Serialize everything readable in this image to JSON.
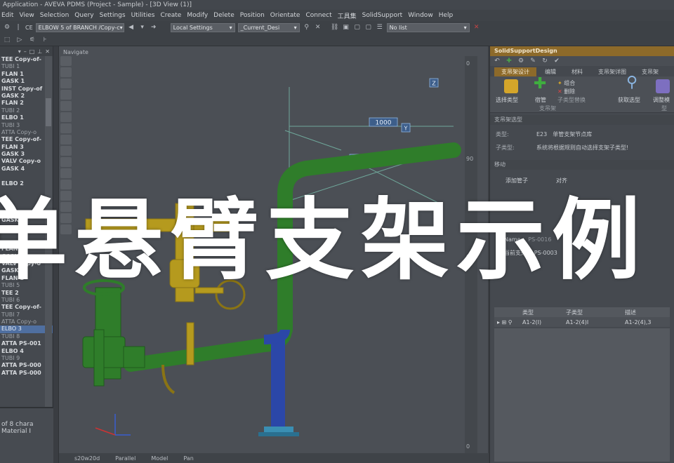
{
  "window": {
    "title": "Application - AVEVA PDMS (Project - Sample) - [3D View (1)]"
  },
  "menu": [
    "Edit",
    "View",
    "Selection",
    "Query",
    "Settings",
    "Utilities",
    "Create",
    "Modify",
    "Delete",
    "Position",
    "Orientate",
    "Connect",
    "工具集",
    "SolidSupport",
    "Window",
    "Help"
  ],
  "toolbar": {
    "ce_label": "CE",
    "ce_value": "ELBOW 5 of BRANCH /Copy-c",
    "settings_value": "Local Settings",
    "design_value": "_Current_Desi",
    "list_value": "No list"
  },
  "tree": {
    "items": [
      {
        "label": "TEE Copy-of-",
        "style": "bold"
      },
      {
        "label": "TUBI 1",
        "style": "dim"
      },
      {
        "label": "FLAN 1",
        "style": "bold"
      },
      {
        "label": "GASK 1",
        "style": "bold"
      },
      {
        "label": "INST Copy-of",
        "style": "bold"
      },
      {
        "label": "GASK 2",
        "style": "bold"
      },
      {
        "label": "FLAN 2",
        "style": "bold"
      },
      {
        "label": "TUBI 2",
        "style": "dim"
      },
      {
        "label": "ELBO 1",
        "style": "bold"
      },
      {
        "label": "TUBI 3",
        "style": "dim"
      },
      {
        "label": "ATTA Copy-o",
        "style": "dim"
      },
      {
        "label": "TEE Copy-of-",
        "style": "bold"
      },
      {
        "label": "FLAN 3",
        "style": "bold"
      },
      {
        "label": "GASK 3",
        "style": "bold"
      },
      {
        "label": "VALV Copy-o",
        "style": "bold"
      },
      {
        "label": "GASK 4",
        "style": "bold"
      },
      {
        "label": "",
        "style": "dim"
      },
      {
        "label": "ELBO 2",
        "style": "bold"
      },
      {
        "label": "",
        "style": "dim"
      },
      {
        "label": "",
        "style": "dim"
      },
      {
        "label": "",
        "style": "dim"
      },
      {
        "label": "",
        "style": "dim"
      },
      {
        "label": "GASK",
        "style": "bold"
      },
      {
        "label": "",
        "style": "dim"
      },
      {
        "label": "",
        "style": "dim"
      },
      {
        "label": "",
        "style": "dim"
      },
      {
        "label": "FLAN",
        "style": "bold"
      },
      {
        "label": "GASK",
        "style": "bold"
      },
      {
        "label": "VALV Copy-o",
        "style": "bold"
      },
      {
        "label": "GASK 8",
        "style": "bold"
      },
      {
        "label": "FLAN 1",
        "style": "bold"
      },
      {
        "label": "TUBI 5",
        "style": "dim"
      },
      {
        "label": "TEE 2",
        "style": "bold"
      },
      {
        "label": "TUBI 6",
        "style": "dim"
      },
      {
        "label": "TEE Copy-of-",
        "style": "bold"
      },
      {
        "label": "TUBI 7",
        "style": "dim"
      },
      {
        "label": "ATTA Copy-o",
        "style": "dim"
      },
      {
        "label": "ELBO 3",
        "style": "sel"
      },
      {
        "label": "TUBI 8",
        "style": "dim"
      },
      {
        "label": "ATTA PS-001",
        "style": "bold"
      },
      {
        "label": "ELBO 4",
        "style": "bold"
      },
      {
        "label": "TUBI 9",
        "style": "dim"
      },
      {
        "label": "ATTA PS-000",
        "style": "bold"
      },
      {
        "label": "ATTA PS-000",
        "style": "bold"
      }
    ]
  },
  "left_bottom": {
    "line1": "of 8 chara",
    "line2": "Material I"
  },
  "viewport": {
    "title": "Navigate",
    "dimension_label": "1000",
    "axis_z": "Z",
    "axis_y": "Y",
    "ruler": [
      "0",
      "90",
      "90",
      "0"
    ],
    "status": [
      "s20w20d",
      "Parallel",
      "Model",
      "Pan"
    ]
  },
  "right_panel": {
    "title": "SolidSupportDesign",
    "tabs": [
      "支吊架设计",
      "编辑",
      "材料",
      "支吊架详图",
      "支吊架"
    ],
    "ribbon": {
      "select_type": "选择类型",
      "grid": "宿管",
      "build": "组合",
      "delete": "删除",
      "sub_replace": "子类型替换",
      "group_label": "支吊架",
      "get_select": "获取选型",
      "adjust": "调整模",
      "right_group": "型"
    },
    "selection": {
      "header": "支吊架选型",
      "type_key": "类型:",
      "type_code": "E23",
      "type_value": "单管支架节点库",
      "subtype_key": "子类型:",
      "subtype_value": "系统将根据规则自动选择支架子类型!"
    },
    "move_header": "移动",
    "add_pipe": "添加管子",
    "align_label": "对齐",
    "name_key": "Name:",
    "name_value": "PS-0016",
    "current_key": "当前支架:",
    "current_value": "PS-0003",
    "grid": {
      "headers": [
        "",
        "类型",
        "子类型",
        "描述"
      ],
      "row": [
        "",
        "A1-2(I)",
        "A1-2(4)I",
        "A1-2(4),3"
      ]
    }
  },
  "overlay": {
    "caption": "单悬臂支架示例"
  },
  "colors": {
    "pipe_green": "#2f7d2a",
    "pipe_blue": "#2b47a8",
    "valve_yellow": "#b59a1e",
    "accent_gold": "#8d6a2a"
  }
}
